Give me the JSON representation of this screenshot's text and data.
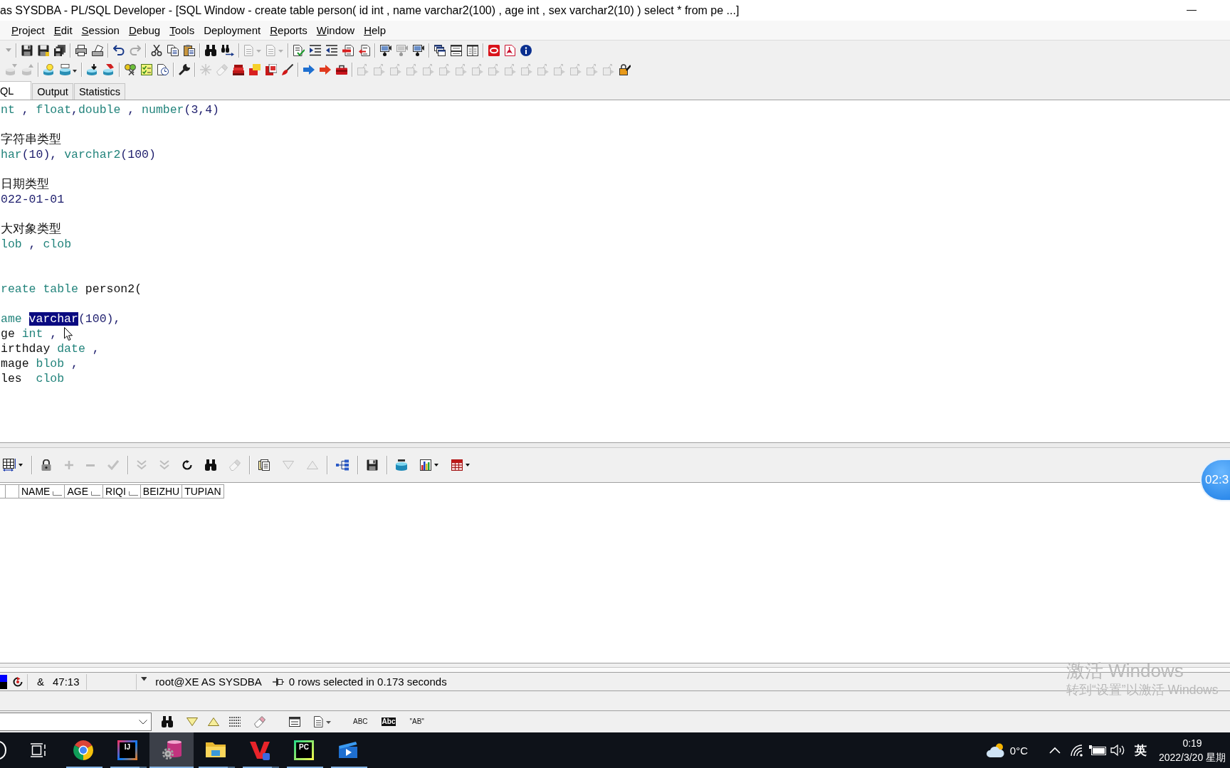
{
  "window": {
    "title": "as SYSDBA - PL/SQL Developer - [SQL Window - create table person( id int , name varchar2(100) , age int , sex varchar2(10) ) select * from pe ...]"
  },
  "menu": [
    {
      "label": "Project",
      "mnemonic": true
    },
    {
      "label": "Edit",
      "mnemonic": true
    },
    {
      "label": "Session",
      "mnemonic": true
    },
    {
      "label": "Debug",
      "mnemonic": true
    },
    {
      "label": "Tools",
      "mnemonic": true
    },
    {
      "label": "Deployment",
      "mnemonic": false
    },
    {
      "label": "Reports",
      "mnemonic": true
    },
    {
      "label": "Window",
      "mnemonic": true
    },
    {
      "label": "Help",
      "mnemonic": true
    }
  ],
  "toolbar_1": {
    "groups": [
      [
        {
          "disabled": true
        }
      ],
      [
        {
          "disabled": false
        },
        {
          "disabled": false
        },
        {
          "disabled": false
        }
      ],
      [
        {
          "disabled": false
        },
        {
          "disabled": false
        }
      ],
      [
        {
          "disabled": false
        },
        {
          "disabled": true
        }
      ],
      [
        {
          "disabled": false
        },
        {
          "disabled": false
        },
        {
          "disabled": false
        }
      ],
      [
        {
          "disabled": false
        },
        {
          "disabled": false
        }
      ],
      [
        {
          "disabled": true
        },
        {
          "disabled": true
        }
      ],
      [
        {
          "disabled": false
        },
        {
          "disabled": false
        },
        {
          "disabled": false
        },
        {
          "disabled": false
        },
        {
          "disabled": false
        }
      ],
      [
        {
          "disabled": false
        },
        {
          "disabled": true
        },
        {
          "disabled": false
        }
      ],
      [
        {
          "disabled": false
        },
        {
          "disabled": false
        },
        {
          "disabled": false
        }
      ],
      [
        {
          "disabled": false
        },
        {
          "disabled": false
        },
        {
          "disabled": false
        }
      ]
    ]
  },
  "toolbar_2": {
    "groups": [
      [
        {
          "disabled": true
        },
        {
          "disabled": true
        }
      ],
      [
        {
          "disabled": false
        },
        {
          "disabled": false
        }
      ],
      [
        {
          "disabled": false
        },
        {
          "disabled": false
        }
      ],
      [
        {
          "disabled": false
        },
        {
          "disabled": false
        },
        {
          "disabled": false
        }
      ],
      [
        {
          "disabled": false
        }
      ],
      [
        {
          "disabled": true
        },
        {
          "disabled": true
        },
        {
          "disabled": false
        },
        {
          "disabled": false
        },
        {
          "disabled": false
        },
        {
          "disabled": false
        }
      ],
      [
        {
          "disabled": false
        },
        {
          "disabled": false
        },
        {
          "disabled": false
        }
      ],
      [
        {
          "disabled": true
        },
        {
          "disabled": true
        },
        {
          "disabled": true
        },
        {
          "disabled": true
        },
        {
          "disabled": true
        },
        {
          "disabled": true
        },
        {
          "disabled": true
        },
        {
          "disabled": true
        },
        {
          "disabled": true
        },
        {
          "disabled": true
        },
        {
          "disabled": true
        },
        {
          "disabled": true
        },
        {
          "disabled": true
        },
        {
          "disabled": true
        },
        {
          "disabled": true
        },
        {
          "disabled": true
        },
        {
          "disabled": false
        }
      ]
    ]
  },
  "tabs": [
    {
      "label": "QL",
      "selected": true
    },
    {
      "label": "Output",
      "selected": false
    },
    {
      "label": "Statistics",
      "selected": false
    }
  ],
  "editor": {
    "lines": [
      {
        "kind": "code",
        "segments": [
          {
            "text": "nt",
            "kind": "keyword",
            "selected": false
          },
          {
            "text": " , ",
            "kind": "symbol",
            "selected": false
          },
          {
            "text": "float",
            "kind": "keyword",
            "selected": false
          },
          {
            "text": ",",
            "kind": "symbol",
            "selected": false
          },
          {
            "text": "double",
            "kind": "keyword",
            "selected": false
          },
          {
            "text": " , ",
            "kind": "symbol",
            "selected": false
          },
          {
            "text": "number",
            "kind": "keyword",
            "selected": false
          },
          {
            "text": "(3,4)",
            "kind": "symbol",
            "selected": false
          }
        ]
      },
      {
        "kind": "blank"
      },
      {
        "kind": "code",
        "segments": [
          {
            "text": "字符串类型",
            "kind": "plain",
            "selected": false
          }
        ]
      },
      {
        "kind": "code",
        "segments": [
          {
            "text": "har",
            "kind": "keyword",
            "selected": false
          },
          {
            "text": "(10), ",
            "kind": "symbol",
            "selected": false
          },
          {
            "text": "varchar2",
            "kind": "keyword",
            "selected": false
          },
          {
            "text": "(100)",
            "kind": "symbol",
            "selected": false
          }
        ]
      },
      {
        "kind": "blank"
      },
      {
        "kind": "code",
        "segments": [
          {
            "text": "日期类型",
            "kind": "plain",
            "selected": false
          }
        ]
      },
      {
        "kind": "code",
        "segments": [
          {
            "text": "022-01-01",
            "kind": "symbol",
            "selected": false
          }
        ]
      },
      {
        "kind": "blank"
      },
      {
        "kind": "code",
        "segments": [
          {
            "text": "大对象类型",
            "kind": "plain",
            "selected": false
          }
        ]
      },
      {
        "kind": "code",
        "segments": [
          {
            "text": "lob",
            "kind": "keyword",
            "selected": false
          },
          {
            "text": " , ",
            "kind": "symbol",
            "selected": false
          },
          {
            "text": "clob",
            "kind": "keyword",
            "selected": false
          }
        ]
      },
      {
        "kind": "blank"
      },
      {
        "kind": "blank"
      },
      {
        "kind": "code",
        "segments": [
          {
            "text": "reate table",
            "kind": "keyword",
            "selected": false
          },
          {
            "text": " person2(",
            "kind": "plain",
            "selected": false
          }
        ]
      },
      {
        "kind": "blank"
      },
      {
        "kind": "code",
        "segments": [
          {
            "text": "ame ",
            "kind": "keyword",
            "selected": false
          },
          {
            "text": "varchar",
            "kind": "keyword",
            "selected": true
          },
          {
            "text": "(100),",
            "kind": "symbol",
            "selected": false
          }
        ]
      },
      {
        "kind": "code",
        "segments": [
          {
            "text": "ge",
            "kind": "plain",
            "selected": false
          },
          {
            "text": " int",
            "kind": "keyword",
            "selected": false
          },
          {
            "text": " ,",
            "kind": "symbol",
            "selected": false
          }
        ]
      },
      {
        "kind": "code",
        "segments": [
          {
            "text": "irthday",
            "kind": "plain",
            "selected": false
          },
          {
            "text": " date",
            "kind": "keyword",
            "selected": false
          },
          {
            "text": " ,",
            "kind": "symbol",
            "selected": false
          }
        ]
      },
      {
        "kind": "code",
        "segments": [
          {
            "text": "mage",
            "kind": "plain",
            "selected": false
          },
          {
            "text": " blob",
            "kind": "keyword",
            "selected": false
          },
          {
            "text": " ,",
            "kind": "symbol",
            "selected": false
          }
        ]
      },
      {
        "kind": "code",
        "segments": [
          {
            "text": "les",
            "kind": "plain",
            "selected": false
          },
          {
            "text": "  clob",
            "kind": "keyword",
            "selected": false
          }
        ]
      }
    ]
  },
  "results": {
    "toolbar": {
      "groups": [
        [
          {
            "disabled": false
          }
        ],
        [
          {
            "disabled": false
          },
          {
            "disabled": true
          },
          {
            "disabled": true
          },
          {
            "disabled": true
          }
        ],
        [
          {
            "disabled": true
          },
          {
            "disabled": true
          },
          {
            "disabled": false
          },
          {
            "disabled": false
          },
          {
            "disabled": true
          }
        ],
        [
          {
            "disabled": false
          },
          {
            "disabled": true
          },
          {
            "disabled": true
          }
        ],
        [
          {
            "disabled": false
          }
        ],
        [
          {
            "disabled": false
          }
        ],
        [
          {
            "disabled": false
          },
          {
            "disabled": false
          },
          {
            "disabled": false
          }
        ]
      ]
    },
    "columns": [
      {
        "label": "NAME",
        "button": true
      },
      {
        "label": "AGE",
        "button": true
      },
      {
        "label": "RIQI",
        "button": true
      },
      {
        "label": "BEIZHU",
        "button": false
      },
      {
        "label": "TUPIAN",
        "button": false
      }
    ]
  },
  "status_bar": {
    "modifier": "&",
    "position": "47:13",
    "connection": "root@XE AS SYSDBA",
    "message": "0 rows selected in 0.173 seconds"
  },
  "find_bar": {
    "options": [
      {
        "label": "ABC",
        "kind": "plain"
      },
      {
        "label": "Abc",
        "kind": "inverted"
      },
      {
        "label": "\"AB\"",
        "kind": "plain"
      }
    ]
  },
  "recorder": {
    "timer": "02:3"
  },
  "activation_notice": {
    "title": "激活 Windows",
    "hint": "转到“设置”以激活 Windows"
  },
  "taskbar": {
    "apps": [
      {
        "running": true,
        "active": false,
        "stacked": false
      },
      {
        "logo": "IJ",
        "running": true,
        "active": false,
        "stacked": true
      },
      {
        "running": true,
        "active": true,
        "stacked": false
      },
      {
        "running": true,
        "active": false,
        "stacked": true
      },
      {
        "running": true,
        "active": false,
        "stacked": true
      },
      {
        "logo": "PC",
        "running": true,
        "active": false,
        "stacked": false
      },
      {
        "running": true,
        "active": false,
        "stacked": false
      }
    ],
    "temperature": "0°C",
    "input_method": "英",
    "time": "0:19",
    "date": "2022/3/20 星期"
  }
}
